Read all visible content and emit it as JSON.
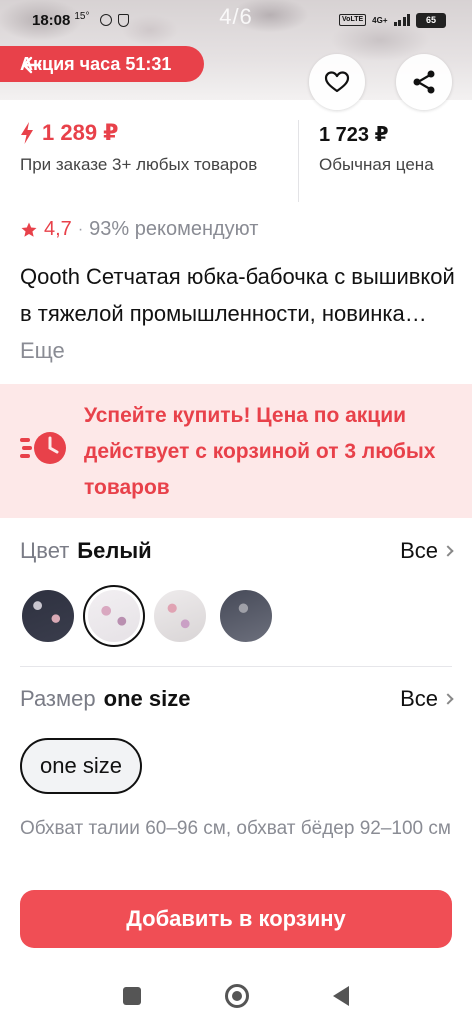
{
  "status_bar": {
    "time": "18:08",
    "temperature": "15°",
    "volte": "VoLTE",
    "network": "4G+",
    "battery": "65"
  },
  "gallery": {
    "counter": "4/6"
  },
  "promo_ribbon": {
    "label": "Акция часа 51:31"
  },
  "price": {
    "promo_price": "1 289 ₽",
    "promo_condition": "При заказе 3+ любых товаров",
    "regular_price": "1 723 ₽",
    "regular_label": "Обычная цена"
  },
  "rating": {
    "value": "4,7",
    "separator": "·",
    "recommend": "93% рекомендуют"
  },
  "product": {
    "title": "Qooth Сетчатая юбка-бабочка с вышивкой в тяжелой промышленности, новинка…",
    "more_label": "Еще"
  },
  "promo_banner": {
    "text": "Успейте купить! Цена по акции действует с корзиной от 3 любых товаров"
  },
  "color": {
    "label": "Цвет",
    "value": "Белый",
    "all_label": "Все"
  },
  "size": {
    "label": "Размер",
    "value": "one size",
    "all_label": "Все",
    "option": "one size",
    "note": "Обхват талии 60–96 см, обхват бёдер 92–100 см"
  },
  "cta": {
    "label": "Добавить в корзину"
  },
  "colors": {
    "accent": "#e8414a",
    "banner_bg": "#fde8e8",
    "cta_bg": "#f04e55"
  }
}
